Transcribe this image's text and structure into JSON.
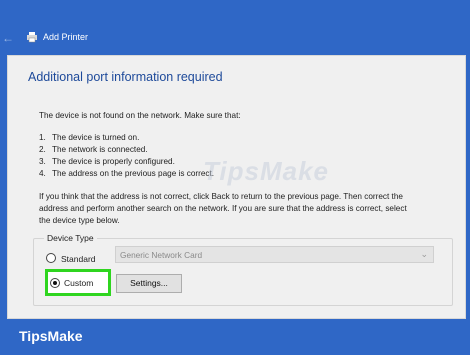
{
  "window": {
    "title": "Add Printer",
    "back_icon": "back-arrow-icon",
    "app_icon": "printer-icon"
  },
  "page": {
    "heading": "Additional port information required",
    "intro": "The device is not found on the network. Make sure that:",
    "checklist": [
      {
        "num": "1.",
        "text": "The device is turned on."
      },
      {
        "num": "2.",
        "text": "The network is connected."
      },
      {
        "num": "3.",
        "text": "The device is properly configured."
      },
      {
        "num": "4.",
        "text": "The address on the previous page is correct."
      }
    ],
    "help_lines": [
      "If you think that the address is not correct, click Back to return to the previous page. Then correct the",
      "address and perform another search on the network. If you are sure that the address is correct, select",
      "the device type below."
    ]
  },
  "device_type": {
    "label": "Device Type",
    "standard_label": "Standard",
    "standard_selected": false,
    "standard_value": "Generic Network Card",
    "custom_label": "Custom",
    "custom_selected": true,
    "settings_button": "Settings..."
  },
  "watermark": "TipsMake",
  "footer": {
    "brand": "TipsMake"
  },
  "colors": {
    "frame": "#2f67c6",
    "heading": "#1e4a9a",
    "highlight": "#2fd51f"
  }
}
